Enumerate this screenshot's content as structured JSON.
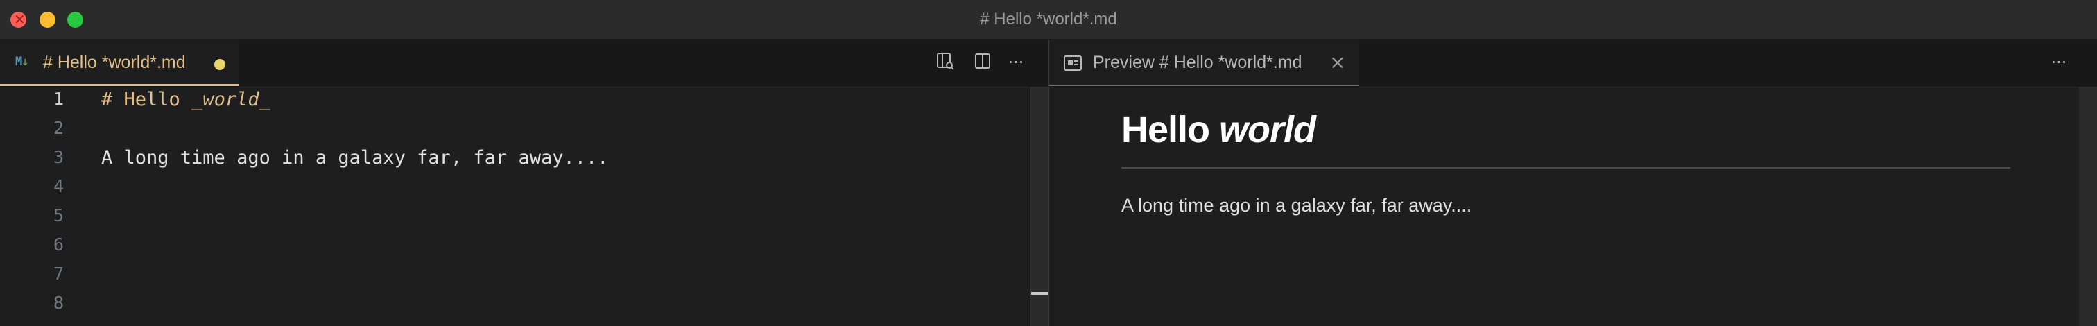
{
  "window": {
    "title": "# Hello *world*.md"
  },
  "left_editor": {
    "tab": {
      "icon": "markdown-icon",
      "icon_text": "M↓",
      "label": "# Hello *world*.md",
      "dirty": true
    },
    "actions": [
      {
        "name": "open-preview-to-side-icon"
      },
      {
        "name": "split-editor-icon"
      },
      {
        "name": "more-actions-icon",
        "glyph": "···"
      }
    ],
    "lines": [
      {
        "number": "1",
        "hash": "#",
        "heading": " Hello ",
        "italic": "_world_",
        "text": ""
      },
      {
        "number": "2",
        "text": ""
      },
      {
        "number": "3",
        "text": "A long time ago in a galaxy far, far away...."
      },
      {
        "number": "4",
        "text": ""
      },
      {
        "number": "5",
        "text": ""
      },
      {
        "number": "6",
        "text": ""
      },
      {
        "number": "7",
        "text": ""
      },
      {
        "number": "8",
        "text": ""
      }
    ]
  },
  "right_editor": {
    "tab": {
      "icon": "preview-icon",
      "label": "Preview # Hello *world*.md",
      "close": "×"
    },
    "more": "···",
    "preview": {
      "heading_plain": "Hello ",
      "heading_italic": "world",
      "paragraph": "A long time ago in a galaxy far, far away...."
    }
  }
}
